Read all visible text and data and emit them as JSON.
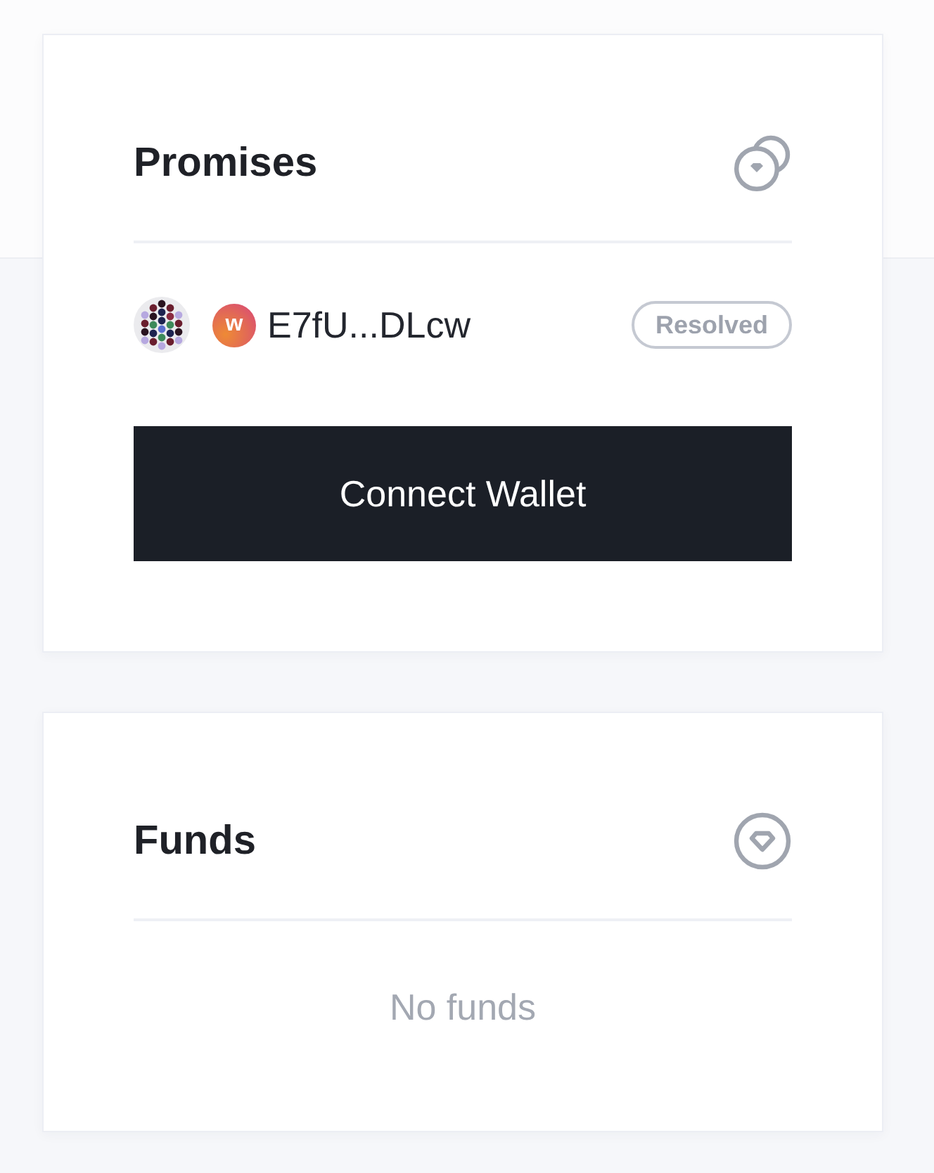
{
  "promises": {
    "title": "Promises",
    "items": [
      {
        "token_letter": "w",
        "address": "E7fU...DLcw",
        "status": "Resolved"
      }
    ],
    "button": "Connect Wallet"
  },
  "funds": {
    "title": "Funds",
    "empty_text": "No funds"
  }
}
